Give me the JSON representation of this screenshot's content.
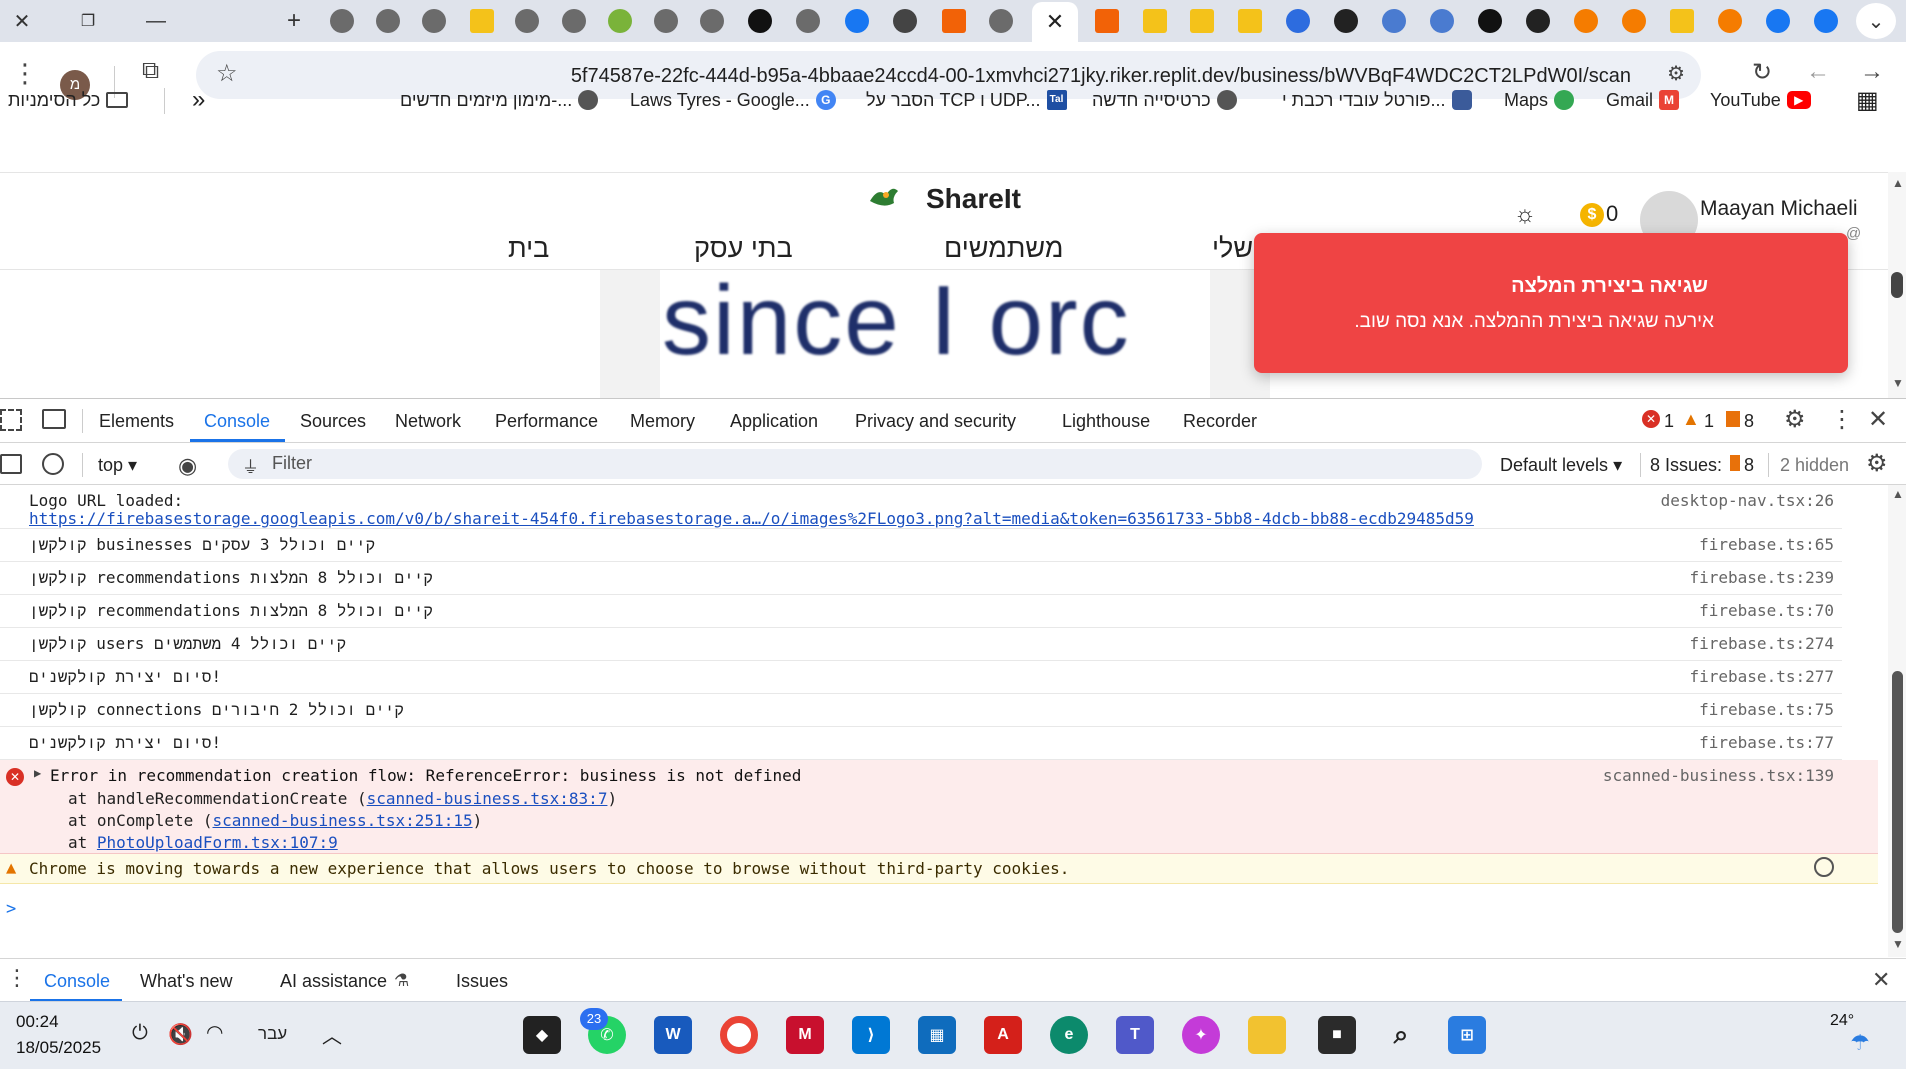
{
  "tabs": {
    "window_controls": {
      "close": "✕",
      "restore": "❐",
      "minimize": "—"
    },
    "new_tab": "+",
    "active_close": "✕",
    "more": "⌄"
  },
  "toolbar": {
    "url": "5f74587e-22fc-444d-b95a-4bbaae24ccd4-00-1xmvhci271jky.riker.replit.dev/business/bWVBqF4WDC2CT2LPdW0I/scan",
    "profile_initial": "מ"
  },
  "bookmarks": {
    "items": [
      {
        "label": "YouTube",
        "icon": "youtube-icon",
        "color": "#ff0000"
      },
      {
        "label": "Gmail",
        "icon": "gmail-icon",
        "color": "#ea4335"
      },
      {
        "label": "Maps",
        "icon": "maps-icon",
        "color": "#34a853"
      },
      {
        "label": "פורטל עובדי רכבת י...",
        "icon": "lock-icon",
        "color": "#3b5b9a"
      },
      {
        "label": "כרטיסייה חדשה",
        "icon": "globe-icon",
        "color": "#555555"
      },
      {
        "label": "הסבר על TCP ו UDP...",
        "icon": "tal-icon",
        "color": "#1e4fa3"
      },
      {
        "label": "Laws Tyres - Google...",
        "icon": "google-icon",
        "color": "#4285f4"
      },
      {
        "label": "מימון מיזמים חדשים-...",
        "icon": "globe-icon",
        "color": "#555555"
      }
    ],
    "overflow": "»",
    "all_bookmarks": "כל הסימניות"
  },
  "page": {
    "brand": "ShareIt",
    "user_name": "Maayan Michaeli",
    "user_sub": "@",
    "coins": "0",
    "nav": [
      "בית",
      "בתי עסק",
      "משתמשים",
      "שלי"
    ],
    "image_text": "since I orc",
    "toast": {
      "title": "שגיאה ביצירת המלצה",
      "message": "אירעה שגיאה ביצירת ההמלצה. אנא נסה שוב."
    }
  },
  "devtools": {
    "tabs": [
      "Elements",
      "Console",
      "Sources",
      "Network",
      "Performance",
      "Memory",
      "Application",
      "Privacy and security",
      "Lighthouse",
      "Recorder"
    ],
    "active_tab": "Console",
    "counts": {
      "errors": "1",
      "warnings": "1",
      "issues": "8"
    },
    "filterbar": {
      "context": "top",
      "filter_placeholder": "Filter",
      "levels": "Default levels",
      "issues_label": "8 Issues:",
      "issues_count": "8",
      "hidden": "2 hidden"
    },
    "logs": [
      {
        "type": "info",
        "text": "Logo URL loaded:",
        "link": "https://firebasestorage.googleapis.com/v0/b/shareit-454f0.firebasestorage.a…/o/images%2FLogo3.png?alt=media&token=63561733-5bb8-4dcb-bb88-ecdb29485d59",
        "source": "desktop-nav.tsx:26"
      },
      {
        "type": "info",
        "text": "קולקשן businesses קיים וכולל 3 עסקים",
        "source": "firebase.ts:65"
      },
      {
        "type": "info",
        "text": "קולקשן recommendations קיים וכולל 8 המלצות",
        "source": "firebase.ts:239"
      },
      {
        "type": "info",
        "text": "קולקשן recommendations קיים וכולל 8 המלצות",
        "source": "firebase.ts:70"
      },
      {
        "type": "info",
        "text": "קולקשן users קיים וכולל 4 משתמשים",
        "source": "firebase.ts:274"
      },
      {
        "type": "info",
        "text": "סיום יצירת קולקשנים!",
        "source": "firebase.ts:277"
      },
      {
        "type": "info",
        "text": "קולקשן connections קיים וכולל 2 חיבורים",
        "source": "firebase.ts:75"
      },
      {
        "type": "info",
        "text": "סיום יצירת קולקשנים!",
        "source": "firebase.ts:77"
      }
    ],
    "error": {
      "text": "Error in recommendation creation flow: ReferenceError: business is not defined",
      "source": "scanned-business.tsx:139",
      "stack": [
        {
          "prefix": "at handleRecommendationCreate (",
          "link": "scanned-business.tsx:83:7",
          "suffix": ")"
        },
        {
          "prefix": "at onComplete (",
          "link": "scanned-business.tsx:251:15",
          "suffix": ")"
        },
        {
          "prefix": "at ",
          "link": "PhotoUploadForm.tsx:107:9",
          "suffix": ""
        }
      ]
    },
    "warning": "Chrome is moving towards a new experience that allows users to choose to browse without third-party cookies.",
    "prompt": ">",
    "drawer_tabs": [
      "Console",
      "What's new",
      "AI assistance",
      "Issues"
    ]
  },
  "taskbar": {
    "time": "00:24",
    "date": "18/05/2025",
    "lang": "עבר",
    "weather": "24°",
    "whatsapp_badge": "23"
  },
  "colors": {
    "toast": "#ef4444",
    "error_bg": "#fdecec",
    "warning_bg": "#fefbe6",
    "link": "#1a4fbf",
    "active_tab_underline": "#1a73e8"
  }
}
